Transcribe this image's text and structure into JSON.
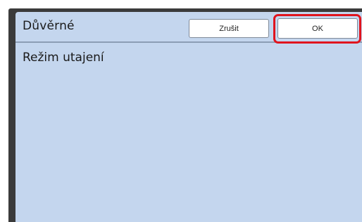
{
  "dialog": {
    "title": "Důvěrné",
    "cancel_label": "Zrušit",
    "ok_label": "OK",
    "setting_label": "Režim utajení"
  },
  "colors": {
    "panel_background": "#c4d6ee",
    "highlight": "#e0141e"
  }
}
